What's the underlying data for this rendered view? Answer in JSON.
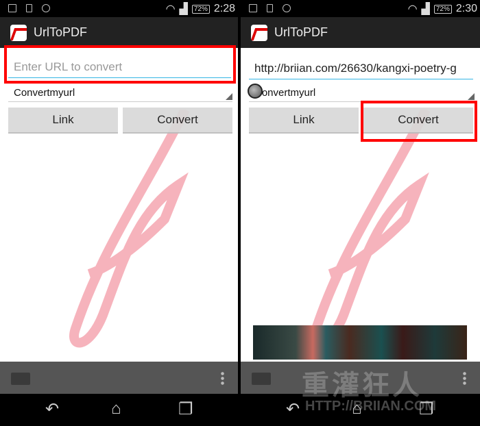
{
  "screens": [
    {
      "status": {
        "battery": "72%",
        "time": "2:28"
      },
      "app_title": "UrlToPDF",
      "url_input": {
        "value": "",
        "placeholder": "Enter URL to  convert"
      },
      "spinner": "Convertmyurl",
      "link_label": "Link",
      "convert_label": "Convert",
      "highlight": "url-input"
    },
    {
      "status": {
        "battery": "72%",
        "time": "2:30"
      },
      "app_title": "UrlToPDF",
      "url_input": {
        "value": "http://briian.com/26630/kangxi-poetry-g",
        "placeholder": ""
      },
      "spinner": "Convertmyurl",
      "link_label": "Link",
      "convert_label": "Convert",
      "highlight": "convert-button"
    }
  ],
  "colors": {
    "highlight": "#ff0000",
    "accent": "#33b5e5",
    "watermark": "#f08090"
  },
  "watermark": {
    "title": "重灌狂人",
    "url": "HTTP://BRIIAN.COM"
  },
  "icons": [
    "image-icon",
    "phone-icon",
    "alarm-icon",
    "wifi-icon",
    "signal-icon",
    "battery-icon",
    "folder-icon",
    "overflow-menu-icon",
    "back-icon",
    "home-icon",
    "recent-apps-icon"
  ]
}
